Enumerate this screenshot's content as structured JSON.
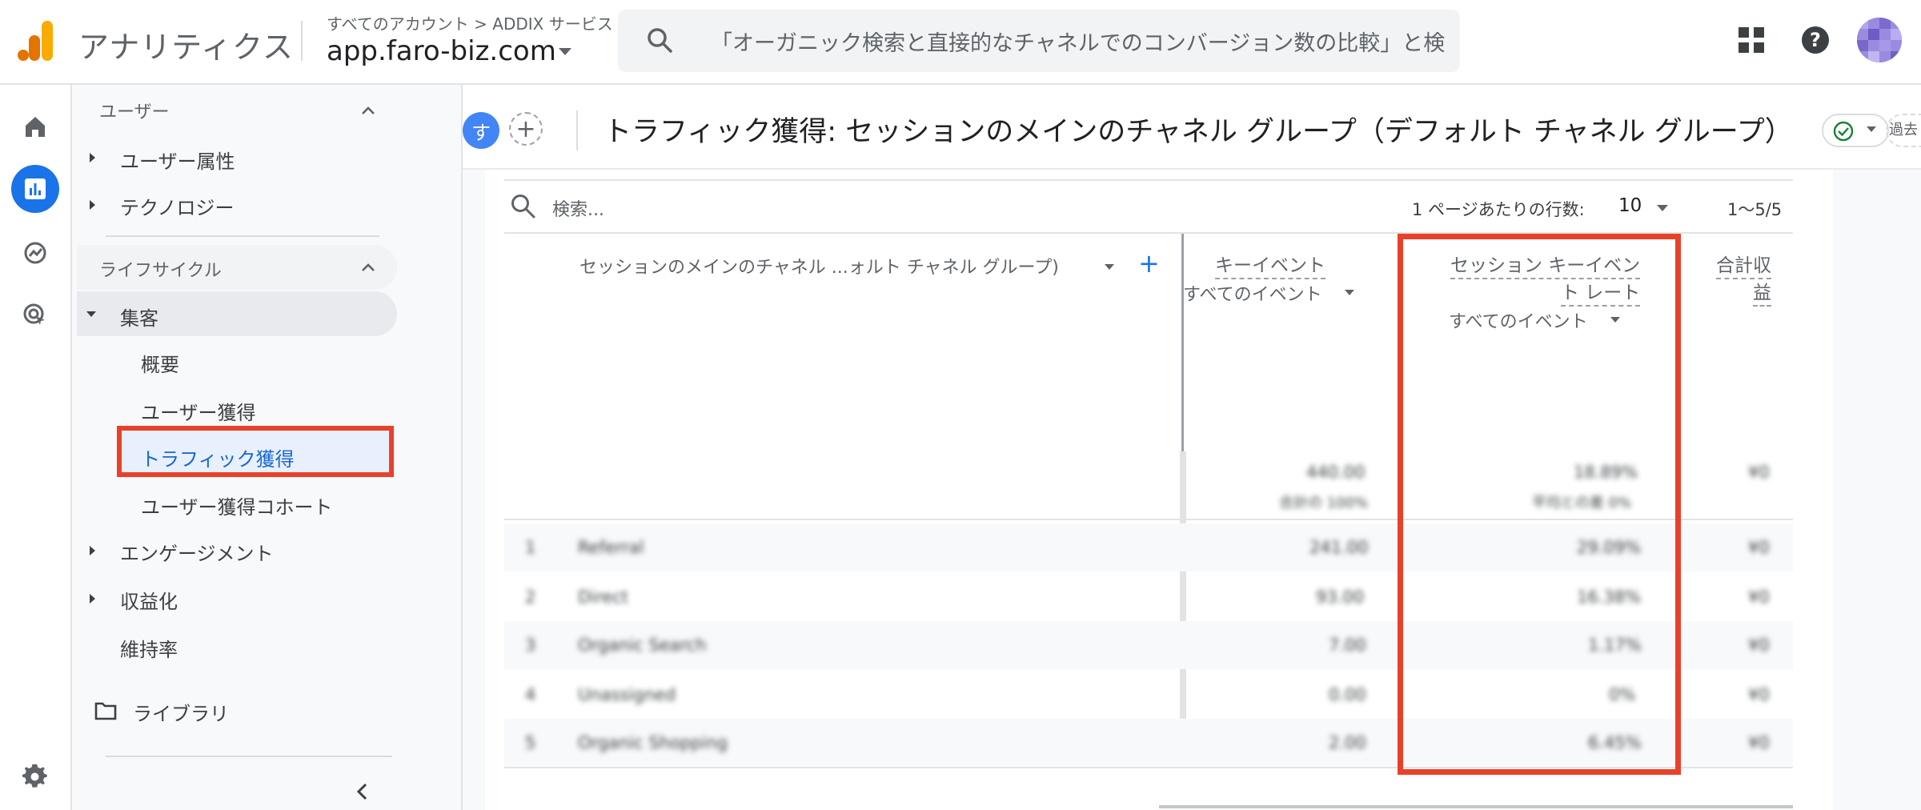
{
  "topbar": {
    "app_name": "アナリティクス",
    "breadcrumb": "すべてのアカウント > ADDIX サービス",
    "property": "app.faro-biz.com",
    "search_placeholder": "「オーガニック検索と直接的なチャネルでのコンバージョン数の比較」と検…",
    "icons": [
      "apps-icon",
      "help-icon",
      "avatar"
    ]
  },
  "rail": {
    "items": [
      "home-icon",
      "reports-icon",
      "explore-icon",
      "advertising-icon"
    ],
    "settings": "settings-icon",
    "accent": "#1a73e8"
  },
  "sidebar": {
    "section_user": "ユーザー",
    "user_attributes": "ユーザー属性",
    "technology": "テクノロジー",
    "section_lifecycle": "ライフサイクル",
    "acquisition": "集客",
    "overview": "概要",
    "user_acquisition": "ユーザー獲得",
    "traffic_acquisition": "トラフィック獲得",
    "user_acq_cohort": "ユーザー獲得コホート",
    "engagement": "エンゲージメント",
    "monetization": "収益化",
    "retention": "維持率",
    "library": "ライブラリ"
  },
  "header": {
    "compare_chip": "す",
    "add_compare": "+",
    "title": "トラフィック獲得: セッションのメインのチャネル グループ（デフォルト チャネル グループ）",
    "date_chip": "過去"
  },
  "table": {
    "search_placeholder": "検索...",
    "rows_per_page_label": "1 ページあたりの行数:",
    "rows_per_page_value": "10",
    "pager": "1〜5/5",
    "dimension_header": "セッションのメインのチャネル ...ォルト チャネル グループ)",
    "add_dimension": "+",
    "col1": {
      "title": "キーイベント",
      "sub": "すべてのイベント"
    },
    "col2": {
      "title_line1": "セッション キーイベン",
      "title_line2": "ト レート",
      "sub": "すべてのイベント"
    },
    "col3": {
      "title_line1": "合計収",
      "title_line2": "益"
    },
    "totals": {
      "col1": "440.00",
      "col1_sub": "合計の 100%",
      "col2": "18.89%",
      "col2_sub": "平均との差 0%",
      "col3": "¥0"
    },
    "rows": [
      {
        "index": "1",
        "channel": "Referral",
        "key_events": "241.00",
        "rate": "29.09%",
        "revenue": "¥0"
      },
      {
        "index": "2",
        "channel": "Direct",
        "key_events": "93.00",
        "rate": "16.38%",
        "revenue": "¥0"
      },
      {
        "index": "3",
        "channel": "Organic Search",
        "key_events": "7.00",
        "rate": "1.17%",
        "revenue": "¥0"
      },
      {
        "index": "4",
        "channel": "Unassigned",
        "key_events": "0.00",
        "rate": "0%",
        "revenue": "¥0"
      },
      {
        "index": "5",
        "channel": "Organic Shopping",
        "key_events": "2.00",
        "rate": "6.45%",
        "revenue": "¥0"
      }
    ]
  },
  "colors": {
    "highlight": "#e8412a",
    "selected_bg": "#e8f0fe",
    "selected_text": "#1967d2"
  }
}
